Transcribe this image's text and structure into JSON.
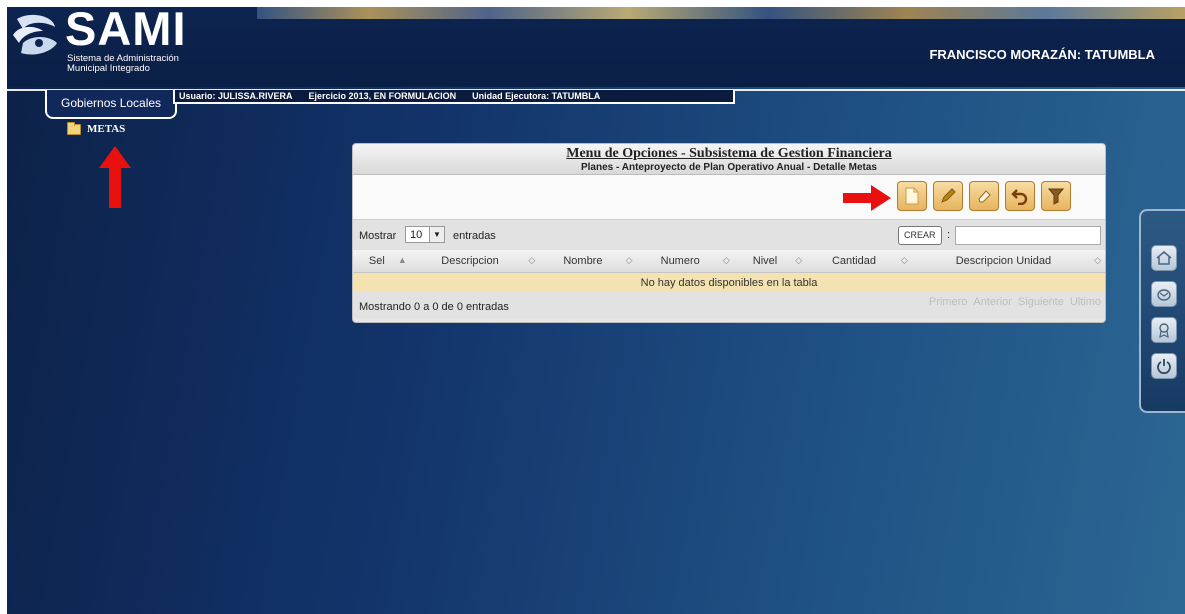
{
  "header": {
    "logo_title": "SAMI",
    "logo_subtitle_1": "Sistema de Administración",
    "logo_subtitle_2": "Municipal Integrado",
    "region": "FRANCISCO MORAZÁN: TATUMBLA"
  },
  "nav": {
    "home_tab": "Gobiernos Locales",
    "user": "Usuario: JULISSA.RIVERA",
    "exercise": "Ejercicio 2013, EN FORMULACION",
    "unit": "Unidad Ejecutora: TATUMBLA"
  },
  "sidebar": {
    "items": [
      {
        "label": "METAS",
        "icon": "folder-icon"
      }
    ]
  },
  "panel": {
    "title": "Menu de Opciones - Subsistema de Gestion Financiera",
    "subtitle": "Planes - Anteproyecto de Plan Operativo Anual - Detalle Metas",
    "toolbar": {
      "buttons": [
        {
          "name": "crear",
          "icon": "new-document-icon"
        },
        {
          "name": "editar",
          "icon": "pencil-icon"
        },
        {
          "name": "borrar",
          "icon": "eraser-icon"
        },
        {
          "name": "regresar",
          "icon": "undo-icon"
        },
        {
          "name": "filtrar",
          "icon": "funnel-icon"
        }
      ],
      "tooltip": "CREAR"
    },
    "controls": {
      "show_label": "Mostrar",
      "page_length": "10",
      "entries_label": "entradas",
      "search_colon": ":"
    },
    "table": {
      "columns": [
        "Sel",
        "Descripcion",
        "Nombre",
        "Numero",
        "Nivel",
        "Cantidad",
        "Descripcion Unidad"
      ],
      "sort_first": "▲",
      "sort_other": "◇",
      "empty_message": "No hay datos disponibles en la tabla"
    },
    "footer": {
      "info": "Mostrando 0 a 0 de 0 entradas",
      "pager": [
        "Primero",
        "Anterior",
        "Siguiente",
        "Ultimo"
      ]
    }
  },
  "dock": {
    "buttons": [
      "home-icon",
      "email-icon",
      "award-icon",
      "power-icon"
    ]
  },
  "colors": {
    "annotation_arrow": "#e8110f",
    "toolbar_button": "#e7b45e",
    "empty_row": "#f4e3b0"
  }
}
